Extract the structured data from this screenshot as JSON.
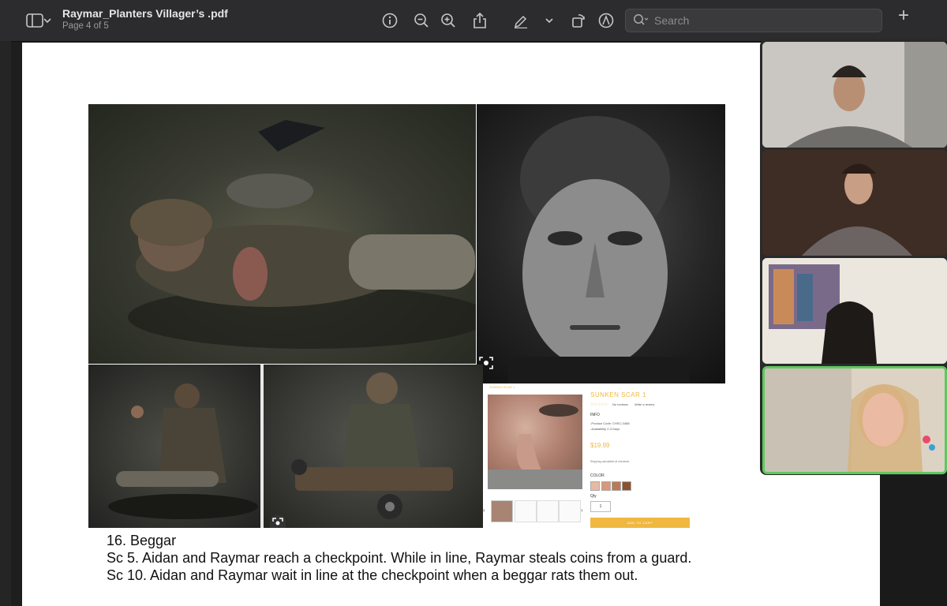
{
  "window": {
    "title": "Raymar_Planters Villager’s .pdf",
    "page_indicator": "Page 4 of 5"
  },
  "toolbar": {
    "search_placeholder": "Search",
    "add_label": "+"
  },
  "icons": [
    "sidebar-icon",
    "chevron-down-icon",
    "info-icon",
    "zoom-out-icon",
    "zoom-in-icon",
    "share-icon",
    "highlight-pen-icon",
    "rotate-icon",
    "markup-icon",
    "search-icon"
  ],
  "product": {
    "breadcrumb": "SUNKEN SCAR 1",
    "title": "SUNKEN SCAR 1",
    "reviews": "No reviews",
    "write_review": "Write a review",
    "info_heading": "INFO",
    "product_code": "-Product Code: CHSC-0488",
    "availability": "-Availability 2-3 Days",
    "price": "$19.99",
    "shipping": "Shipping calculated at checkout.",
    "color_label": "COLOR",
    "qty_label": "Qty",
    "qty_value": "1",
    "add_to_cart": "ADD TO CART",
    "colors": [
      "#e8b9a3",
      "#d9987a",
      "#b97a55",
      "#8a5230"
    ]
  },
  "caption": {
    "line1": "16. Beggar",
    "line2": "Sc 5. Aidan and Raymar reach a checkpoint. While in line, Raymar steals coins from a guard.",
    "line3": "Sc 10. Aidan and Raymar wait in line at the checkpoint when a beggar rats them out."
  },
  "colors": {
    "toolbar": "#2c2b2d",
    "active_speaker": "#5ec95e",
    "accent": "#f0b841"
  }
}
